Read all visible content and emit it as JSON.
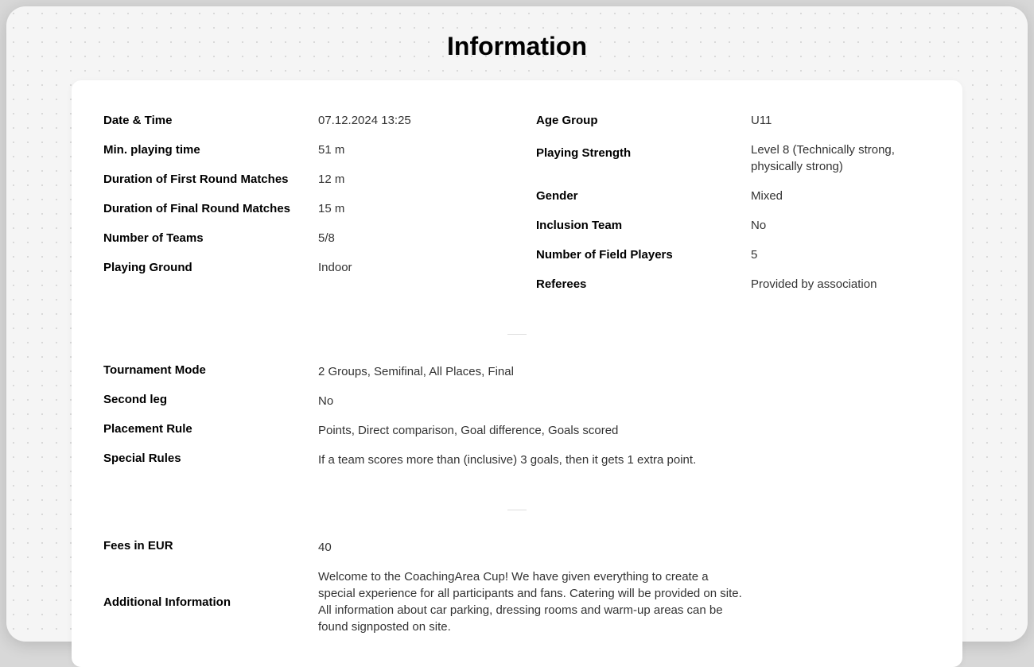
{
  "title": "Information",
  "section1": {
    "left": {
      "date_time_label": "Date & Time",
      "date_time_value": "07.12.2024 13:25",
      "min_playing_time_label": "Min. playing time",
      "min_playing_time_value": "51 m",
      "first_round_label": "Duration of First Round Matches",
      "first_round_value": "12 m",
      "final_round_label": "Duration of Final Round Matches",
      "final_round_value": "15 m",
      "num_teams_label": "Number of Teams",
      "num_teams_value": "5/8",
      "playing_ground_label": "Playing Ground",
      "playing_ground_value": "Indoor"
    },
    "right": {
      "age_group_label": "Age Group",
      "age_group_value": "U11",
      "playing_strength_label": "Playing Strength",
      "playing_strength_value": "Level 8 (Technically strong, physically strong)",
      "gender_label": "Gender",
      "gender_value": "Mixed",
      "inclusion_team_label": "Inclusion Team",
      "inclusion_team_value": "No",
      "field_players_label": "Number of Field Players",
      "field_players_value": "5",
      "referees_label": "Referees",
      "referees_value": "Provided by association"
    }
  },
  "section2": {
    "tournament_mode_label": "Tournament Mode",
    "tournament_mode_value": "2 Groups, Semifinal, All Places, Final",
    "second_leg_label": "Second leg",
    "second_leg_value": "No",
    "placement_rule_label": "Placement Rule",
    "placement_rule_value": "Points, Direct comparison, Goal difference, Goals scored",
    "special_rules_label": "Special Rules",
    "special_rules_value": "If a team scores more than (inclusive) 3 goals, then it gets 1 extra point."
  },
  "section3": {
    "fees_label": "Fees in EUR",
    "fees_value": "40",
    "additional_info_label": "Additional Information",
    "additional_info_value": "Welcome to the CoachingArea Cup! We have given everything to create a special experience for all participants and fans. Catering will be provided on site. All infor­mation about car parking, dressing rooms and warm-up areas can be found signposted on site."
  }
}
